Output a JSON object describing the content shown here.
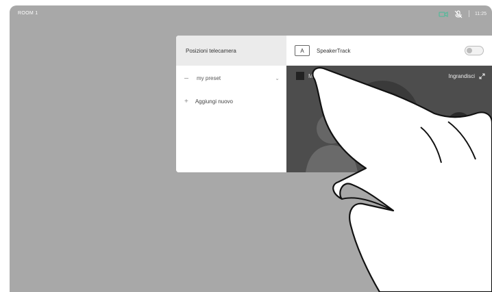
{
  "status_bar": {
    "device_name": "ROOM 1",
    "time": "11:25",
    "icons": [
      "camera-icon",
      "mic-icon"
    ],
    "accent_color": "#5ab89a"
  },
  "camera_panel": {
    "title": "Posizioni telecamera",
    "presets": [
      {
        "label": "my preset",
        "icon": "dash-icon",
        "chevron": "chevron-down-icon"
      }
    ],
    "add_new_label": "Aggiungi nuovo",
    "speakertrack": {
      "icon_label": "A",
      "label": "SpeakerTrack",
      "enabled": false
    },
    "preview": {
      "self_view_label": "Mostra vista",
      "zoom_label": "Ingrandisci"
    }
  }
}
